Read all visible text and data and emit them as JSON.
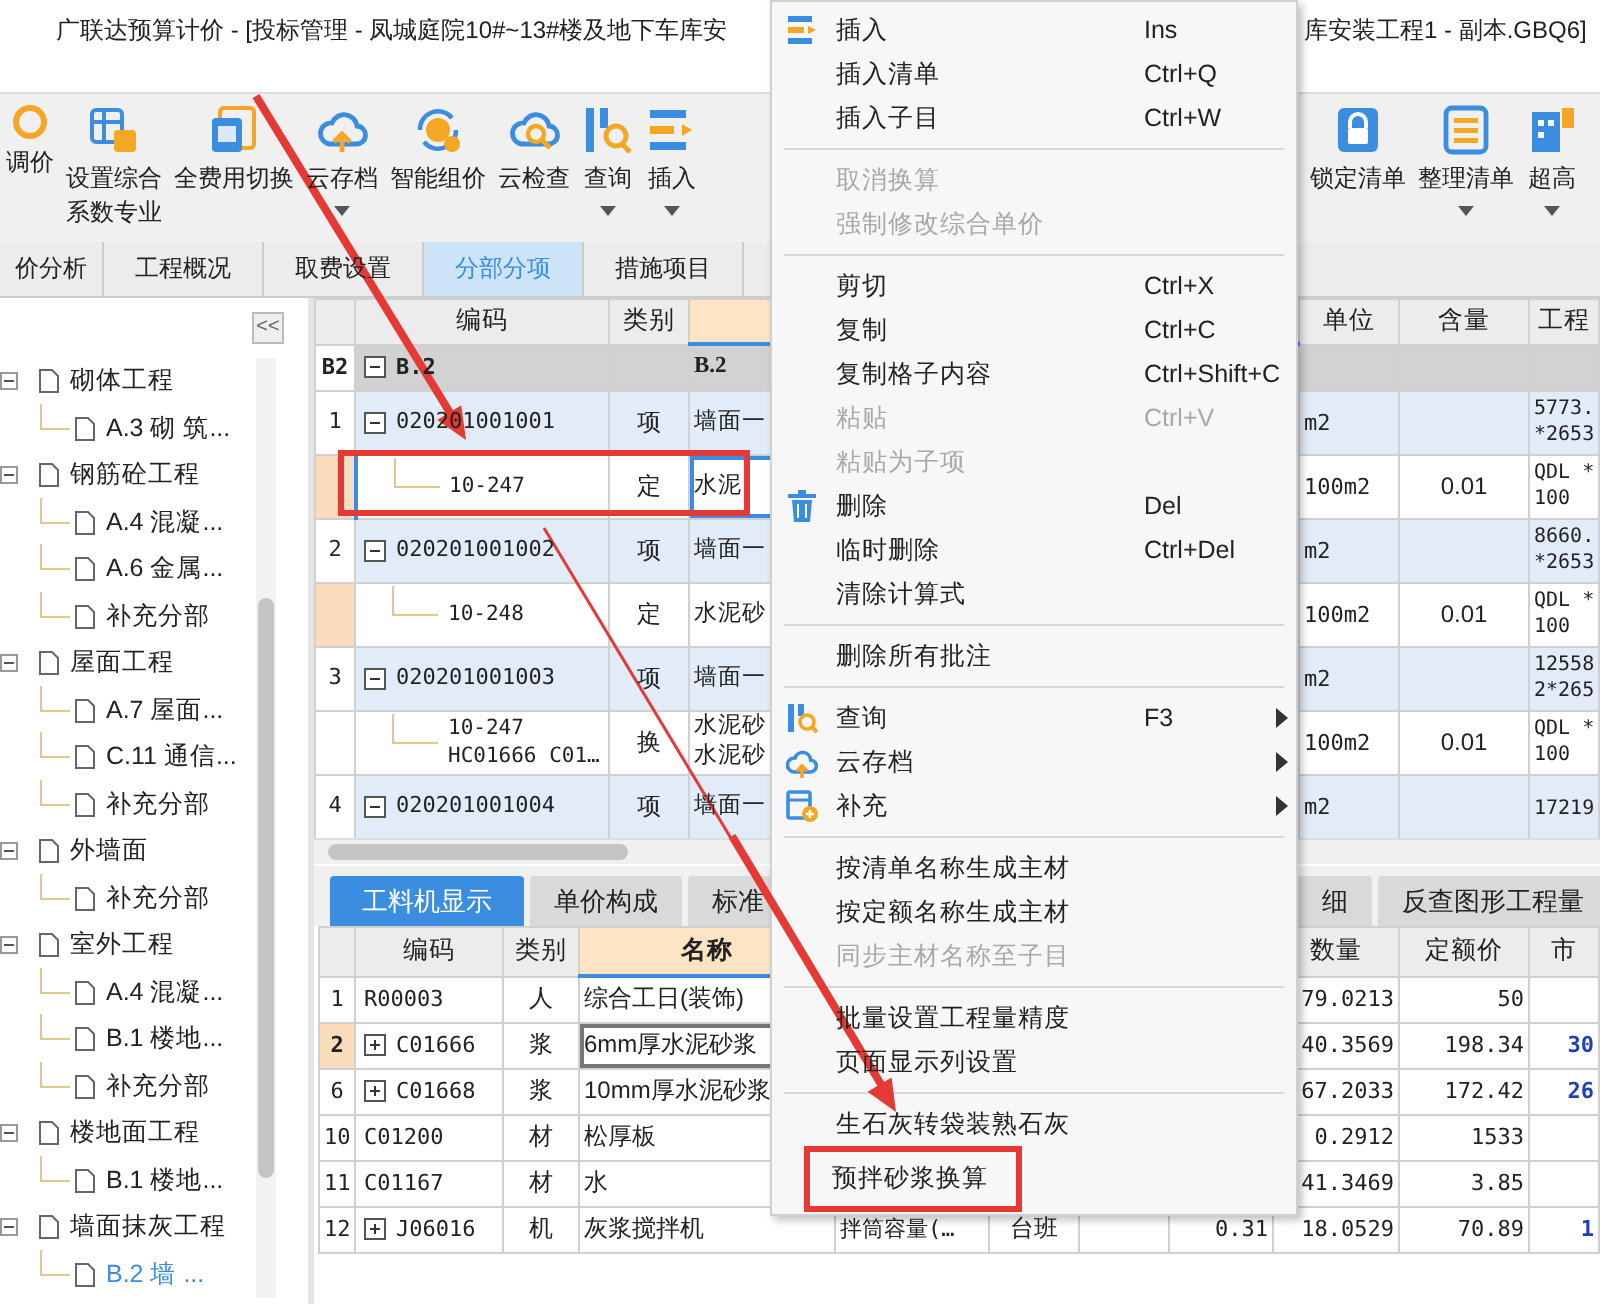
{
  "window": {
    "title_left": "广联达预算计价 - [投标管理 - 凤城庭院10#~13#楼及地下车库安",
    "title_right": "库安装工程1 - 副本.GBQ6]"
  },
  "toolbar": {
    "left": [
      {
        "lines": [
          "调价"
        ],
        "has_menu": false
      },
      {
        "lines": [
          "设置综合",
          "系数专业"
        ],
        "has_menu": false
      },
      {
        "lines": [
          "全费用切换"
        ],
        "has_menu": false
      },
      {
        "lines": [
          "云存档"
        ],
        "has_menu": true
      },
      {
        "lines": [
          "智能组价"
        ],
        "has_menu": false
      },
      {
        "lines": [
          "云检查"
        ],
        "has_menu": false
      },
      {
        "lines": [
          "查询"
        ],
        "has_menu": true
      },
      {
        "lines": [
          "插入"
        ],
        "has_menu": true
      }
    ],
    "right": [
      {
        "lines": [
          "锁定清单"
        ],
        "has_menu": false
      },
      {
        "lines": [
          "整理清单"
        ],
        "has_menu": true
      },
      {
        "lines": [
          "超高"
        ],
        "has_menu": true
      }
    ]
  },
  "tabs": [
    {
      "label": "价分析",
      "selected": false
    },
    {
      "label": "工程概况",
      "selected": false
    },
    {
      "label": "取费设置",
      "selected": false
    },
    {
      "label": "分部分项",
      "selected": true
    },
    {
      "label": "措施项目",
      "selected": false
    }
  ],
  "sidebar": {
    "collapse_button": "<<",
    "tree": [
      {
        "label": "砌体工程",
        "expanded": true,
        "selected": false,
        "children": [
          {
            "label": "A.3  砌 筑...",
            "selected": false
          }
        ]
      },
      {
        "label": "钢筋砼工程",
        "expanded": true,
        "selected": false,
        "children": [
          {
            "label": "A.4  混凝...",
            "selected": false
          },
          {
            "label": "A.6  金属...",
            "selected": false
          },
          {
            "label": "补充分部",
            "selected": false
          }
        ]
      },
      {
        "label": "屋面工程",
        "expanded": true,
        "selected": false,
        "children": [
          {
            "label": "A.7  屋面...",
            "selected": false
          },
          {
            "label": "C.11  通信...",
            "selected": false
          },
          {
            "label": "补充分部",
            "selected": false
          }
        ]
      },
      {
        "label": "外墙面",
        "expanded": true,
        "selected": false,
        "children": [
          {
            "label": "补充分部",
            "selected": false
          }
        ]
      },
      {
        "label": "室外工程",
        "expanded": true,
        "selected": false,
        "children": [
          {
            "label": "A.4  混凝...",
            "selected": false
          },
          {
            "label": "B.1  楼地...",
            "selected": false
          },
          {
            "label": "补充分部",
            "selected": false
          }
        ]
      },
      {
        "label": "楼地面工程",
        "expanded": true,
        "selected": false,
        "children": [
          {
            "label": "B.1  楼地...",
            "selected": false
          }
        ]
      },
      {
        "label": "墙面抹灰工程",
        "expanded": true,
        "selected": false,
        "children": [
          {
            "label": "B.2  墙 ...",
            "selected": true
          }
        ]
      }
    ]
  },
  "upper_grid": {
    "columns": [
      {
        "current": false
      },
      {
        "label": "编码",
        "current": false
      },
      {
        "label": "类别",
        "current": false
      },
      {
        "current": true
      },
      {
        "label": "单位",
        "current": false
      },
      {
        "label": "含量",
        "current": false
      },
      {
        "label": "工程",
        "current": false
      }
    ],
    "rows": [
      {
        "kind": "section",
        "num": "B2",
        "code": [
          "B.2"
        ],
        "name": [
          "B.2"
        ],
        "highlighted": false,
        "selected": false,
        "marked": false
      },
      {
        "kind": "item",
        "num": "1",
        "code": [
          "020201001001"
        ],
        "type": "项",
        "name": [
          "墙面一"
        ],
        "unit": "m2",
        "quantity": [
          "5773.",
          "*2653"
        ],
        "highlighted": false,
        "selected": false,
        "marked": false
      },
      {
        "kind": "sub",
        "code": [
          "10-247"
        ],
        "type": "定",
        "name": [
          "水泥"
        ],
        "unit": "100m2",
        "content": "0.01",
        "quantity": [
          "QDL *",
          "100"
        ],
        "highlighted": true,
        "selected": true,
        "marked": true
      },
      {
        "kind": "item",
        "num": "2",
        "code": [
          "020201001002"
        ],
        "type": "项",
        "name": [
          "墙面一"
        ],
        "unit": "m2",
        "quantity": [
          "8660.",
          "*2653"
        ],
        "highlighted": false,
        "selected": false,
        "marked": false
      },
      {
        "kind": "sub",
        "code": [
          "10-248"
        ],
        "type": "定",
        "name": [
          "水泥砂"
        ],
        "unit": "100m2",
        "content": "0.01",
        "quantity": [
          "QDL *",
          "100"
        ],
        "highlighted": true,
        "selected": false,
        "marked": false
      },
      {
        "kind": "item",
        "num": "3",
        "code": [
          "020201001003"
        ],
        "type": "项",
        "name": [
          "墙面一"
        ],
        "unit": "m2",
        "quantity": [
          "12558",
          "2*265"
        ],
        "highlighted": false,
        "selected": false,
        "marked": false
      },
      {
        "kind": "sub",
        "code": [
          "10-247",
          "HC01666 C01…"
        ],
        "type": "换",
        "name": [
          "水泥砂",
          "水泥砂"
        ],
        "unit": "100m2",
        "content": "0.01",
        "quantity": [
          "QDL *",
          "100"
        ],
        "highlighted": false,
        "selected": false,
        "marked": false
      },
      {
        "kind": "item",
        "num": "4",
        "code": [
          "020201001004"
        ],
        "type": "项",
        "name": [
          "墙面一"
        ],
        "unit": "m2",
        "quantity": [
          "17219"
        ],
        "highlighted": false,
        "selected": false,
        "marked": false
      }
    ]
  },
  "lower_tabs": {
    "left": [
      {
        "label": "工料机显示",
        "selected": true
      },
      {
        "label": "单价构成",
        "selected": false
      },
      {
        "label": "标准",
        "selected": false
      }
    ],
    "right": [
      {
        "label": "细",
        "selected": false
      },
      {
        "label": "反查图形工程量",
        "selected": false
      }
    ]
  },
  "lower_grid": {
    "columns": [
      {
        "current": false
      },
      {
        "label": "编码",
        "current": false
      },
      {
        "label": "类别",
        "current": false
      },
      {
        "label": "名称",
        "current": true
      },
      {},
      {},
      {},
      {},
      {
        "label": "数量",
        "current": false
      },
      {
        "label": "定额价",
        "current": false
      },
      {
        "label": "市",
        "current": false
      }
    ],
    "rows": [
      {
        "num": "1",
        "expandable": false,
        "code": "R00003",
        "type": "人",
        "name": "综合工日(装饰)",
        "quantity": "79.0213",
        "price": "50",
        "selected": false
      },
      {
        "num": "2",
        "expandable": true,
        "code": "C01666",
        "type": "浆",
        "name": "6mm厚水泥砂浆",
        "quantity": "40.3569",
        "price": "198.34",
        "market": "30",
        "selected": true
      },
      {
        "num": "6",
        "expandable": true,
        "code": "C01668",
        "type": "浆",
        "name": "10mm厚水泥砂浆",
        "quantity": "67.2033",
        "price": "172.42",
        "market": "26",
        "selected": false
      },
      {
        "num": "10",
        "expandable": false,
        "code": "C01200",
        "type": "材",
        "name": "松厚板",
        "quantity": "0.2912",
        "price": "1533",
        "selected": false
      },
      {
        "num": "11",
        "expandable": false,
        "code": "C01167",
        "type": "材",
        "name": "水",
        "quantity": "41.3469",
        "price": "3.85",
        "selected": false
      },
      {
        "num": "12",
        "expandable": true,
        "code": "J06016",
        "type": "机",
        "name": "灰浆搅拌机",
        "spec": "拌筒容量(…",
        "unit": "台班",
        "column_8": "0.31",
        "quantity": "18.0529",
        "price": "70.89",
        "market": "1",
        "selected": false
      }
    ]
  },
  "context_menu": [
    {
      "kind": "item",
      "label": "插入",
      "shortcut": "Ins",
      "has_icon": true,
      "disabled": false,
      "submenu": false,
      "marked": false
    },
    {
      "kind": "item",
      "label": "插入清单",
      "shortcut": "Ctrl+Q",
      "has_icon": false,
      "disabled": false,
      "submenu": false,
      "marked": false
    },
    {
      "kind": "item",
      "label": "插入子目",
      "shortcut": "Ctrl+W",
      "has_icon": false,
      "disabled": false,
      "submenu": false,
      "marked": false
    },
    {
      "kind": "separator"
    },
    {
      "kind": "item",
      "label": "取消换算",
      "has_icon": false,
      "disabled": true,
      "submenu": false,
      "marked": false
    },
    {
      "kind": "item",
      "label": "强制修改综合单价",
      "has_icon": false,
      "disabled": true,
      "submenu": false,
      "marked": false
    },
    {
      "kind": "separator"
    },
    {
      "kind": "item",
      "label": "剪切",
      "shortcut": "Ctrl+X",
      "has_icon": false,
      "disabled": false,
      "submenu": false,
      "marked": false
    },
    {
      "kind": "item",
      "label": "复制",
      "shortcut": "Ctrl+C",
      "has_icon": false,
      "disabled": false,
      "submenu": false,
      "marked": false
    },
    {
      "kind": "item",
      "label": "复制格子内容",
      "shortcut": "Ctrl+Shift+C",
      "has_icon": false,
      "disabled": false,
      "submenu": false,
      "marked": false
    },
    {
      "kind": "item",
      "label": "粘贴",
      "shortcut": "Ctrl+V",
      "has_icon": false,
      "disabled": true,
      "submenu": false,
      "marked": false
    },
    {
      "kind": "item",
      "label": "粘贴为子项",
      "has_icon": false,
      "disabled": true,
      "submenu": false,
      "marked": false
    },
    {
      "kind": "item",
      "label": "删除",
      "shortcut": "Del",
      "has_icon": true,
      "disabled": false,
      "submenu": false,
      "marked": false
    },
    {
      "kind": "item",
      "label": "临时删除",
      "shortcut": "Ctrl+Del",
      "has_icon": false,
      "disabled": false,
      "submenu": false,
      "marked": false
    },
    {
      "kind": "item",
      "label": "清除计算式",
      "has_icon": false,
      "disabled": false,
      "submenu": false,
      "marked": false
    },
    {
      "kind": "separator"
    },
    {
      "kind": "item",
      "label": "删除所有批注",
      "has_icon": false,
      "disabled": false,
      "submenu": false,
      "marked": false
    },
    {
      "kind": "separator"
    },
    {
      "kind": "item",
      "label": "查询",
      "shortcut": "F3",
      "has_icon": true,
      "disabled": false,
      "submenu": true,
      "marked": false
    },
    {
      "kind": "item",
      "label": "云存档",
      "has_icon": true,
      "disabled": false,
      "submenu": true,
      "marked": false
    },
    {
      "kind": "item",
      "label": "补充",
      "has_icon": true,
      "disabled": false,
      "submenu": true,
      "marked": false
    },
    {
      "kind": "separator"
    },
    {
      "kind": "item",
      "label": "按清单名称生成主材",
      "has_icon": false,
      "disabled": false,
      "submenu": false,
      "marked": false
    },
    {
      "kind": "item",
      "label": "按定额名称生成主材",
      "has_icon": false,
      "disabled": false,
      "submenu": false,
      "marked": false
    },
    {
      "kind": "item",
      "label": "同步主材名称至子目",
      "has_icon": false,
      "disabled": true,
      "submenu": false,
      "marked": false
    },
    {
      "kind": "separator"
    },
    {
      "kind": "item",
      "label": "批量设置工程量精度",
      "has_icon": false,
      "disabled": false,
      "submenu": false,
      "marked": false
    },
    {
      "kind": "item",
      "label": "页面显示列设置",
      "has_icon": false,
      "disabled": false,
      "submenu": false,
      "marked": false
    },
    {
      "kind": "separator"
    },
    {
      "kind": "item",
      "label": "生石灰转袋装熟石灰",
      "has_icon": false,
      "disabled": false,
      "submenu": false,
      "marked": false
    },
    {
      "kind": "item",
      "label": "预拌砂浆换算",
      "has_icon": false,
      "disabled": false,
      "submenu": false,
      "marked": true
    }
  ]
}
